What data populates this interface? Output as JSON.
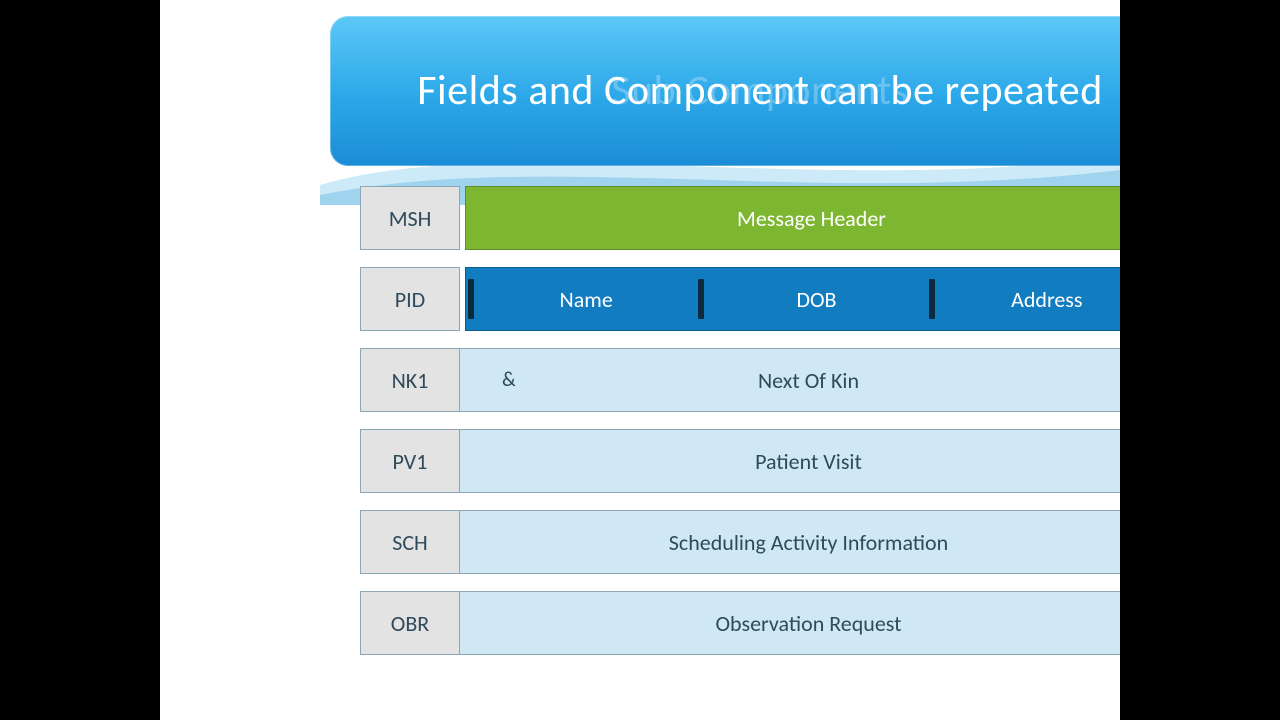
{
  "title": "Fields and Component can be repeated",
  "title_ghost": "Sub Components",
  "segments": [
    {
      "code": "MSH",
      "label": "Message Header",
      "style": "green",
      "fields": null
    },
    {
      "code": "PID",
      "label": null,
      "style": "blue",
      "fields": [
        "Name",
        "DOB",
        "Address"
      ]
    },
    {
      "code": "NK1",
      "label": "Next Of Kin",
      "style": "light",
      "fields": null
    },
    {
      "code": "PV1",
      "label": "Patient Visit",
      "style": "light",
      "fields": null
    },
    {
      "code": "SCH",
      "label": "Scheduling Activity Information",
      "style": "light",
      "fields": null
    },
    {
      "code": "OBR",
      "label": "Observation Request",
      "style": "light",
      "fields": null
    }
  ],
  "nk1_symbol": "&"
}
